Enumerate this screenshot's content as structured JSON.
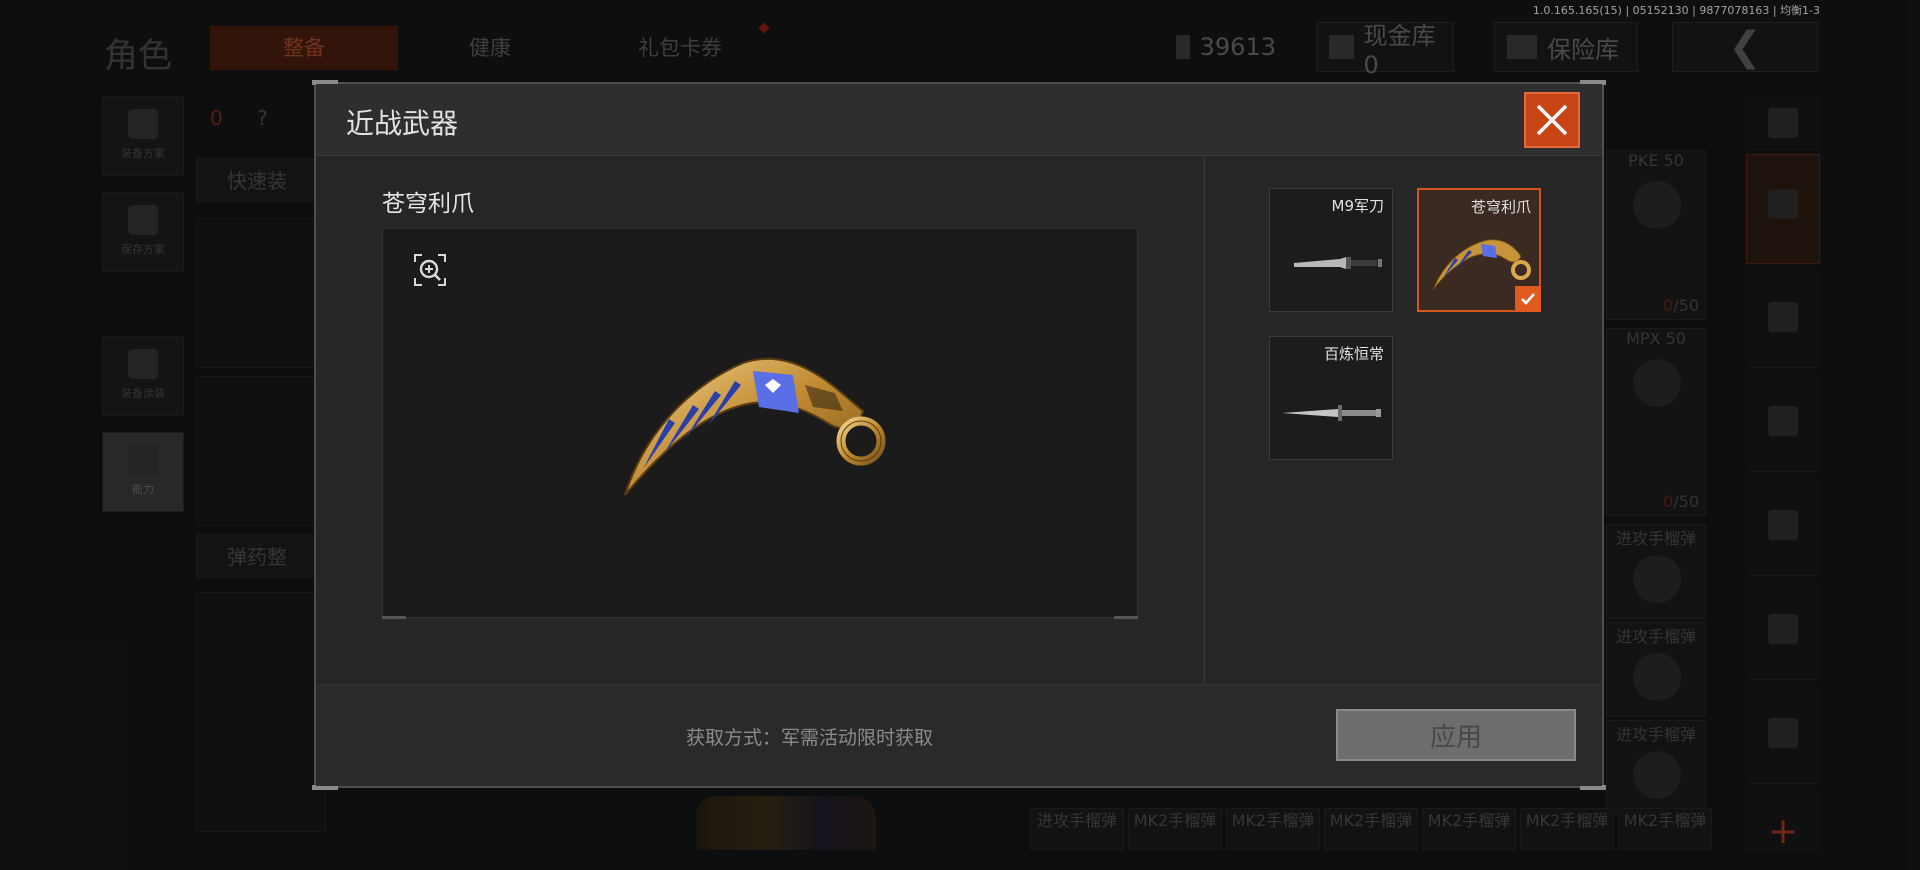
{
  "version_text": "1.0.165.165(15) | 05152130 | 9877078163 | 均衡1-3",
  "topbar": {
    "page_title": "角色",
    "tabs": [
      {
        "label": "整备",
        "active": true
      },
      {
        "label": "健康",
        "active": false
      },
      {
        "label": "礼包卡券",
        "active": false
      }
    ],
    "currency_value": "39613",
    "cash_vault_label": "现金库 0",
    "insurance_label": "保险库"
  },
  "left_rail": {
    "items": [
      {
        "label": "装备方案"
      },
      {
        "label": "保存方案"
      },
      {
        "label": "装备涂装"
      },
      {
        "label": "能力"
      }
    ]
  },
  "left_panel": {
    "armor_count": "0",
    "help": "?",
    "quick_equip_label": "快速装",
    "ammo_label": "弹药整"
  },
  "right_grid": {
    "cells": [
      {
        "label": "PKE 50",
        "count_current": "0",
        "count_total": "/50"
      },
      {
        "label": "MPX 50",
        "count_current": "0",
        "count_total": "/50"
      },
      {
        "label": "进攻手榴弹",
        "count_current": "",
        "count_total": ""
      },
      {
        "label": "进攻手榴弹",
        "count_current": "",
        "count_total": ""
      },
      {
        "label": "进攻手榴弹",
        "count_current": "",
        "count_total": ""
      }
    ]
  },
  "bottom_row": {
    "cells": [
      "进攻手榴弹",
      "MK2手榴弹",
      "MK2手榴弹",
      "MK2手榴弹",
      "MK2手榴弹",
      "MK2手榴弹",
      "MK2手榴弹"
    ]
  },
  "modal": {
    "title": "近战武器",
    "selected_item_name": "苍穹利爪",
    "weapons": [
      {
        "name": "M9军刀",
        "selected": false
      },
      {
        "name": "苍穹利爪",
        "selected": true
      },
      {
        "name": "百炼恒常",
        "selected": false
      }
    ],
    "obtain_text": "获取方式：军需活动限时获取",
    "apply_label": "应用"
  },
  "colors": {
    "accent": "#d4551f",
    "close_bg": "#c94414",
    "modal_bg": "#262626",
    "apply_bg": "#6d6d6d"
  },
  "icons": {
    "close": "close-icon",
    "zoom": "zoom-in-icon",
    "check": "check-icon",
    "back": "chevron-left-icon"
  }
}
